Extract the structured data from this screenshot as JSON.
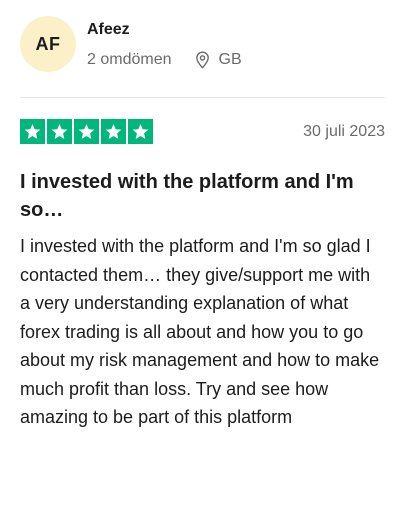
{
  "reviewer": {
    "initials": "AF",
    "name": "Afeez",
    "review_count": "2 omdömen",
    "country": "GB",
    "avatar_color": "#fbf0c7"
  },
  "rating": {
    "stars": 5,
    "max": 5,
    "star_color": "#00b67a"
  },
  "review": {
    "date": "30 juli 2023",
    "title": "I invested with the platform and I'm so…",
    "body": "I invested with the platform and I'm so glad I contacted them… they give/support me with a very understanding explanation of what forex trading is all about and how you to go about my risk management and how to make much profit than loss. Try and see how amazing to be part of this platform"
  },
  "icons": {
    "location": "location-pin-icon",
    "star": "star-icon"
  }
}
